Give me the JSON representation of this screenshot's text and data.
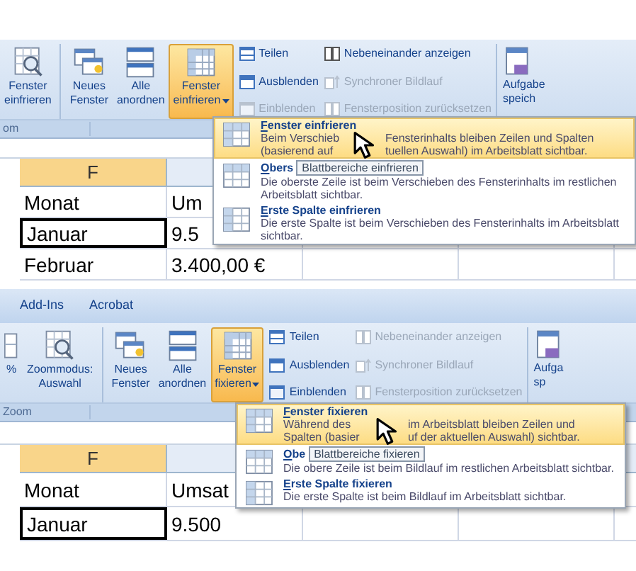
{
  "panels": [
    {
      "ribbon": {
        "group_label": "om",
        "large_buttons": [
          {
            "kind": "zoom-sheet",
            "label": [
              "Fenster",
              "einfrieren"
            ],
            "selected": false,
            "has_menu": false
          },
          {
            "kind": "new-window",
            "label": [
              "Neues",
              "Fenster"
            ],
            "selected": false,
            "has_menu": false
          },
          {
            "kind": "arrange",
            "label": [
              "Alle",
              "anordnen"
            ],
            "selected": false,
            "has_menu": false
          },
          {
            "kind": "freeze",
            "label": [
              "Fenster",
              "einfrieren"
            ],
            "selected": true,
            "has_menu": true
          }
        ],
        "small_columns": [
          [
            {
              "kind": "split",
              "label": "Teilen",
              "disabled": false
            },
            {
              "kind": "hide",
              "label": "Ausblenden",
              "disabled": false
            },
            {
              "kind": "unhide",
              "label": "Einblenden",
              "disabled": true
            }
          ],
          [
            {
              "kind": "side-by-side",
              "label": "Nebeneinander anzeigen",
              "disabled": false
            },
            {
              "kind": "sync-scroll",
              "label": "Synchroner Bildlauf",
              "disabled": true
            },
            {
              "kind": "reset-position",
              "label": "Fensterposition zurücksetzen",
              "disabled": true
            }
          ]
        ],
        "cut_button": [
          "Aufgabe",
          "speich"
        ]
      },
      "sheet": {
        "columns": [
          {
            "label": "F",
            "selected": true
          }
        ],
        "rows": [
          {
            "cells": [
              {
                "text": "Monat",
                "selected": false
              },
              {
                "text": "Um",
                "selected": false
              }
            ]
          },
          {
            "cells": [
              {
                "text": "Januar",
                "selected": true
              },
              {
                "text": "9.5",
                "selected": false
              }
            ]
          },
          {
            "cells": [
              {
                "text": "Februar",
                "selected": false
              },
              {
                "text": "3.400,00 €",
                "selected": false
              }
            ]
          }
        ]
      },
      "menu": {
        "tooltip": "Blattbereiche einfrieren",
        "items": [
          {
            "kind": "freeze-panes",
            "title": "Fenster einfrieren",
            "description_lines": [
              [
                "Beim Verschieb",
                "Fensterinhalts bleiben Zeilen und Spalten"
              ],
              [
                "(basierend auf",
                "tuellen Auswahl) im Arbeitsblatt sichtbar."
              ]
            ],
            "selected": true
          },
          {
            "kind": "freeze-top-row",
            "title": "Obers",
            "description": "Die oberste Zeile ist beim Verschieben des Fensterinhalts im restlichen Arbeitsblatt sichtbar.",
            "selected": false
          },
          {
            "kind": "freeze-first-column",
            "title": "Erste Spalte einfrieren",
            "description": "Die erste Spalte ist beim Verschieben des Fensterinhalts im Arbeitsblatt sichtbar.",
            "selected": false
          }
        ]
      }
    },
    {
      "tabs": [
        "Add-Ins",
        "Acrobat"
      ],
      "ribbon": {
        "group_label": "Zoom",
        "large_buttons": [
          {
            "kind": "percent",
            "label": [
              "%"
            ],
            "selected": false,
            "has_menu": false
          },
          {
            "kind": "zoom-sheet",
            "label": [
              "Zoommodus:",
              "Auswahl"
            ],
            "selected": false,
            "has_menu": false
          },
          {
            "kind": "new-window",
            "label": [
              "Neues",
              "Fenster"
            ],
            "selected": false,
            "has_menu": false
          },
          {
            "kind": "arrange",
            "label": [
              "Alle",
              "anordnen"
            ],
            "selected": false,
            "has_menu": false
          },
          {
            "kind": "freeze",
            "label": [
              "Fenster",
              "fixieren"
            ],
            "selected": true,
            "has_menu": true
          }
        ],
        "small_columns": [
          [
            {
              "kind": "split",
              "label": "Teilen",
              "disabled": false
            },
            {
              "kind": "hide",
              "label": "Ausblenden",
              "disabled": false
            },
            {
              "kind": "unhide",
              "label": "Einblenden",
              "disabled": false
            }
          ],
          [
            {
              "kind": "side-by-side",
              "label": "Nebeneinander anzeigen",
              "disabled": true
            },
            {
              "kind": "sync-scroll",
              "label": "Synchroner Bildlauf",
              "disabled": true
            },
            {
              "kind": "reset-position",
              "label": "Fensterposition zurücksetzen",
              "disabled": true
            }
          ]
        ],
        "cut_button": [
          "Aufga",
          "sp"
        ]
      },
      "sheet": {
        "columns": [
          {
            "label": "F",
            "selected": true
          }
        ],
        "rows": [
          {
            "cells": [
              {
                "text": "Monat",
                "selected": false
              },
              {
                "text": "Umsat",
                "selected": false
              }
            ]
          },
          {
            "cells": [
              {
                "text": "Januar",
                "selected": true
              },
              {
                "text": "9.500",
                "selected": false
              }
            ]
          }
        ]
      },
      "menu": {
        "tooltip": "Blattbereiche fixieren",
        "items": [
          {
            "kind": "freeze-panes",
            "title": "Fenster fixieren",
            "description_lines": [
              [
                "Während des",
                "im Arbeitsblatt bleiben Zeilen und"
              ],
              [
                "Spalten (basier",
                "uf der aktuellen Auswahl) sichtbar."
              ]
            ],
            "selected": true
          },
          {
            "kind": "freeze-top-row",
            "title": "Obe",
            "description": "Die obere Zeile ist beim Bildlauf im restlichen Arbeitsblatt sichtbar.",
            "selected": false
          },
          {
            "kind": "freeze-first-column",
            "title": "Erste Spalte fixieren",
            "description": "Die erste Spalte ist beim Bildlauf im Arbeitsblatt sichtbar.",
            "selected": false
          }
        ]
      }
    }
  ]
}
